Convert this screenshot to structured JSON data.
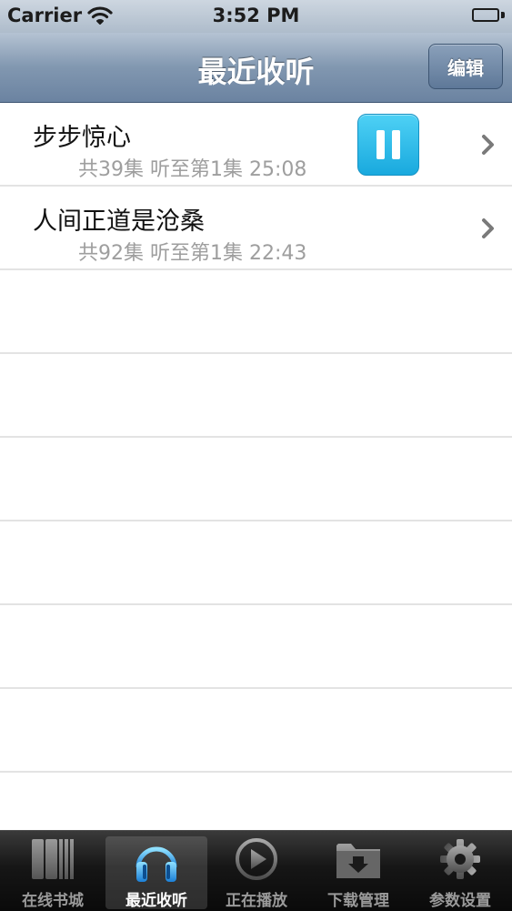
{
  "status_bar": {
    "carrier": "Carrier",
    "time": "3:52 PM"
  },
  "nav": {
    "title": "最近收听",
    "edit_label": "编辑"
  },
  "items": [
    {
      "title": "步步惊心",
      "subtitle": "共39集 听至第1集 25:08",
      "playing": true
    },
    {
      "title": "人间正道是沧桑",
      "subtitle": "共92集 听至第1集 22:43",
      "playing": false
    }
  ],
  "tabs": [
    {
      "label": "在线书城",
      "icon": "bookshelf-icon",
      "active": false
    },
    {
      "label": "最近收听",
      "icon": "headphones-icon",
      "active": true
    },
    {
      "label": "正在播放",
      "icon": "play-circle-icon",
      "active": false
    },
    {
      "label": "下载管理",
      "icon": "download-folder-icon",
      "active": false
    },
    {
      "label": "参数设置",
      "icon": "gear-icon",
      "active": false
    }
  ],
  "colors": {
    "accent": "#19a9de",
    "nav_bar": "#6b83a1",
    "subtitle": "#9e9e9e"
  }
}
